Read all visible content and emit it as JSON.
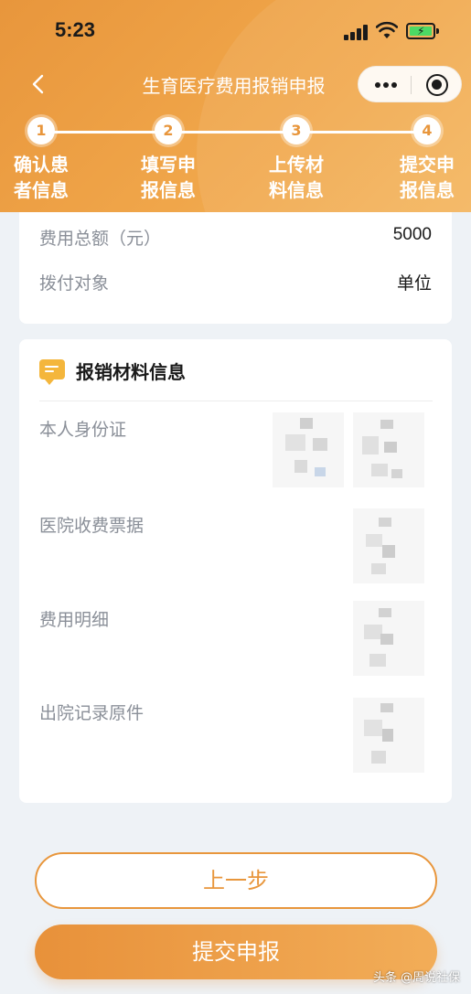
{
  "status_bar": {
    "time": "5:23"
  },
  "nav": {
    "title": "生育医疗费用报销申报"
  },
  "steps": [
    {
      "number": "1",
      "label": "确认患者信息"
    },
    {
      "number": "2",
      "label": "填写申报信息"
    },
    {
      "number": "3",
      "label": "上传材料信息"
    },
    {
      "number": "4",
      "label": "提交申报信息"
    }
  ],
  "summary": {
    "rows": [
      {
        "label": "费用总额（元）",
        "value": "5000"
      },
      {
        "label": "拨付对象",
        "value": "单位"
      }
    ]
  },
  "materials": {
    "title": "报销材料信息",
    "items": [
      {
        "label": "本人身份证"
      },
      {
        "label": "医院收费票据"
      },
      {
        "label": "费用明细"
      },
      {
        "label": "出院记录原件"
      }
    ]
  },
  "buttons": {
    "prev": "上一步",
    "submit": "提交申报"
  },
  "watermark": "头条 @周说社保",
  "colors": {
    "accent": "#e8963c",
    "icon_yellow": "#f4b63c"
  }
}
